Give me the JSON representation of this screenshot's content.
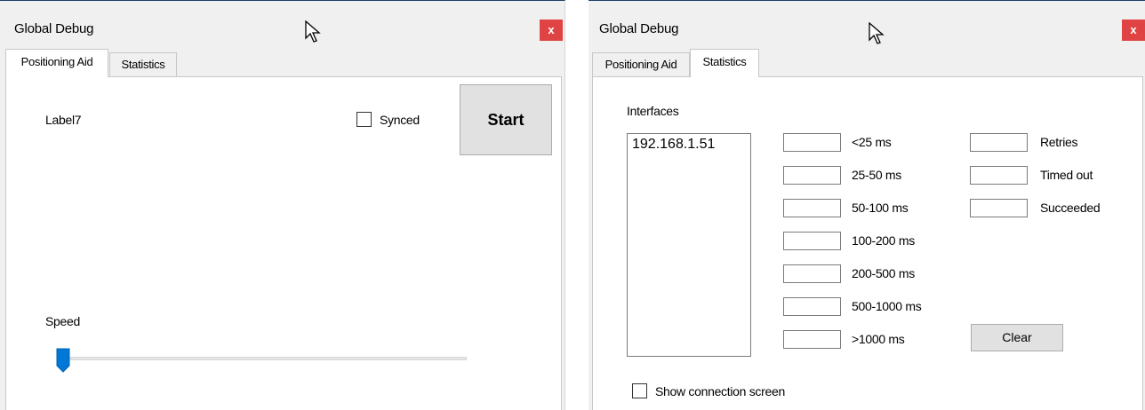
{
  "left_window": {
    "title": "Global Debug",
    "close_label": "x",
    "tabs": [
      {
        "label": "Positioning Aid",
        "active": true
      },
      {
        "label": "Statistics",
        "active": false
      }
    ],
    "label7": "Label7",
    "synced_label": "Synced",
    "synced_checked": false,
    "start_label": "Start",
    "speed_label": "Speed",
    "speed_value_fraction": 0.0
  },
  "right_window": {
    "title": "Global Debug",
    "close_label": "x",
    "tabs": [
      {
        "label": "Positioning Aid",
        "active": false
      },
      {
        "label": "Statistics",
        "active": true
      }
    ],
    "interfaces_label": "Interfaces",
    "interfaces": [
      "192.168.1.51"
    ],
    "latency_buckets": [
      {
        "label": "<25 ms",
        "value": ""
      },
      {
        "label": "25-50 ms",
        "value": ""
      },
      {
        "label": "50-100 ms",
        "value": ""
      },
      {
        "label": "100-200 ms",
        "value": ""
      },
      {
        "label": "200-500 ms",
        "value": ""
      },
      {
        "label": "500-1000 ms",
        "value": ""
      },
      {
        "label": ">1000 ms",
        "value": ""
      }
    ],
    "counters": [
      {
        "label": "Retries",
        "value": ""
      },
      {
        "label": "Timed out",
        "value": ""
      },
      {
        "label": "Succeeded",
        "value": ""
      }
    ],
    "clear_label": "Clear",
    "show_connection_label": "Show connection screen",
    "show_connection_checked": false
  },
  "colors": {
    "close_button": "#e04343",
    "slider_thumb": "#0078d7",
    "title_accent": "#1c3f66"
  }
}
